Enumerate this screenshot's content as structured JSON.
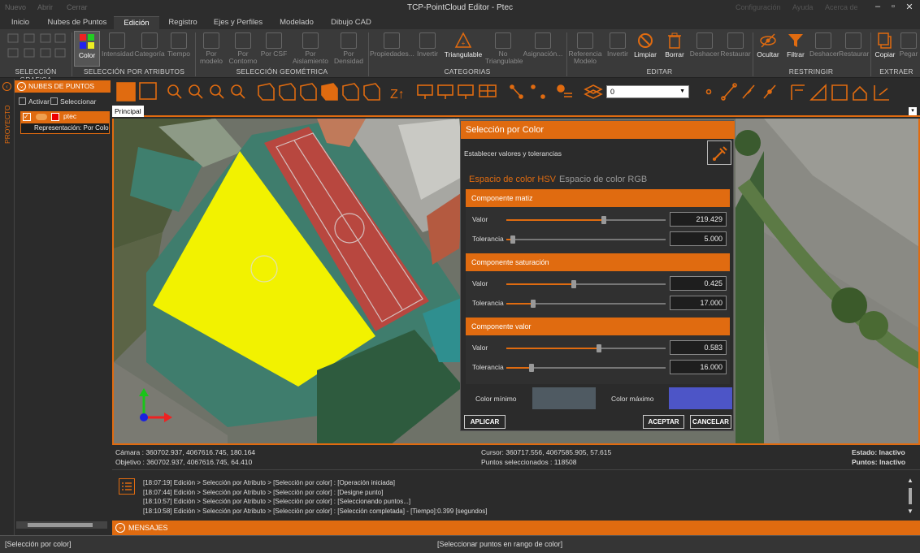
{
  "window": {
    "title": "TCP-PointCloud Editor - Ptec",
    "quick_access": [
      "Nuevo",
      "Abrir",
      "Cerrar"
    ],
    "right_links": [
      "Configuración",
      "Ayuda",
      "Acerca de"
    ]
  },
  "tabs": [
    "Inicio",
    "Nubes de Puntos",
    "Edición",
    "Registro",
    "Ejes y Perfiles",
    "Modelado",
    "Dibujo CAD"
  ],
  "ribbon": {
    "groups": {
      "grafica": "SELECCIÓN GRAFICA",
      "atributos": "SELECCIÓN POR ATRIBUTOS",
      "geometrica": "SELECCIÓN GEOMÉTRICA",
      "categorias": "CATEGORIAS",
      "editar": "EDITAR",
      "restringir": "RESTRINGIR",
      "extraer": "EXTRAER"
    },
    "atributos": [
      "Color",
      "Intensidad",
      "Categoría",
      "Tiempo"
    ],
    "geometrica": [
      "Por modelo",
      "Por Contorno",
      "Por CSF",
      "Por Aislamiento",
      "Por Densidad"
    ],
    "categorias": [
      "Propiedades...",
      "Invertir",
      "Triangulable",
      "No Triangulable",
      "Asignación..."
    ],
    "editar": [
      "Referencia Modelo",
      "Invertir",
      "Limpiar",
      "Borrar",
      "Deshacer",
      "Restaurar"
    ],
    "restringir": [
      "Ocultar",
      "Filtrar",
      "Deshacer",
      "Restaurar"
    ],
    "extraer": [
      "Copiar",
      "Pegar"
    ]
  },
  "left_panel": {
    "strip_label": "PROYECTO",
    "header": "NUBES DE PUNTOS",
    "activar": "Activar",
    "seleccionar": "Seleccionar",
    "cloud_name": "ptec",
    "representation": "Representación: Por Color"
  },
  "toolbar": {
    "layer_value": "0"
  },
  "view_tab": "Principal",
  "status": {
    "camara": "Cámara : 360702.937, 4067616.745, 180.164",
    "objetivo": "Objetivo : 360702.937, 4067616.745, 64.410",
    "cursor": "Cursor: 360717.556, 4067585.905, 57.615",
    "puntos_sel": "Puntos seleccionados : 118508",
    "estado": "Estado: Inactivo",
    "puntos": "Puntos: Inactivo"
  },
  "console": [
    "[18:07:19] Edición > Selección por Atributo > [Selección por color] : [Operación iniciada]",
    "[18:07:44] Edición > Selección por Atributo > [Selección por color] : [Designe punto]",
    "[18:10:57] Edición > Selección por Atributo > [Selección por color] : [Seleccionando puntos...]",
    "[18:10:58] Edición > Selección por Atributo > [Selección por color] : [Selección completada] - [Tiempo]:0.399 [segundos]"
  ],
  "messages_label": "MENSAJES",
  "bottom": {
    "left": "[Selección por color]",
    "center": "[Seleccionar puntos en rango de color]"
  },
  "dialog": {
    "title": "Selección por Color",
    "subtitle": "Establecer valores y tolerancias",
    "tab_hsv": "Espacio de color HSV",
    "tab_rgb": "Espacio de color RGB",
    "sections": [
      {
        "title": "Componente matiz",
        "valor_label": "Valor",
        "valor": "219.429",
        "valor_frac": 0.61,
        "tol_label": "Tolerancia",
        "tol": "5.000",
        "tol_frac": 0.04
      },
      {
        "title": "Componente saturación",
        "valor_label": "Valor",
        "valor": "0.425",
        "valor_frac": 0.425,
        "tol_label": "Tolerancia",
        "tol": "17.000",
        "tol_frac": 0.17
      },
      {
        "title": "Componente valor",
        "valor_label": "Valor",
        "valor": "0.583",
        "valor_frac": 0.583,
        "tol_label": "Tolerancia",
        "tol": "16.000",
        "tol_frac": 0.16
      }
    ],
    "color_min_label": "Color mínimo",
    "color_min": "#4f5a62",
    "color_max_label": "Color máximo",
    "color_max": "#4d55c7",
    "btn_apply": "APLICAR",
    "btn_accept": "ACEPTAR",
    "btn_cancel": "CANCELAR"
  },
  "colors": {
    "accent": "#e06b10",
    "selection": "#ffff00"
  }
}
